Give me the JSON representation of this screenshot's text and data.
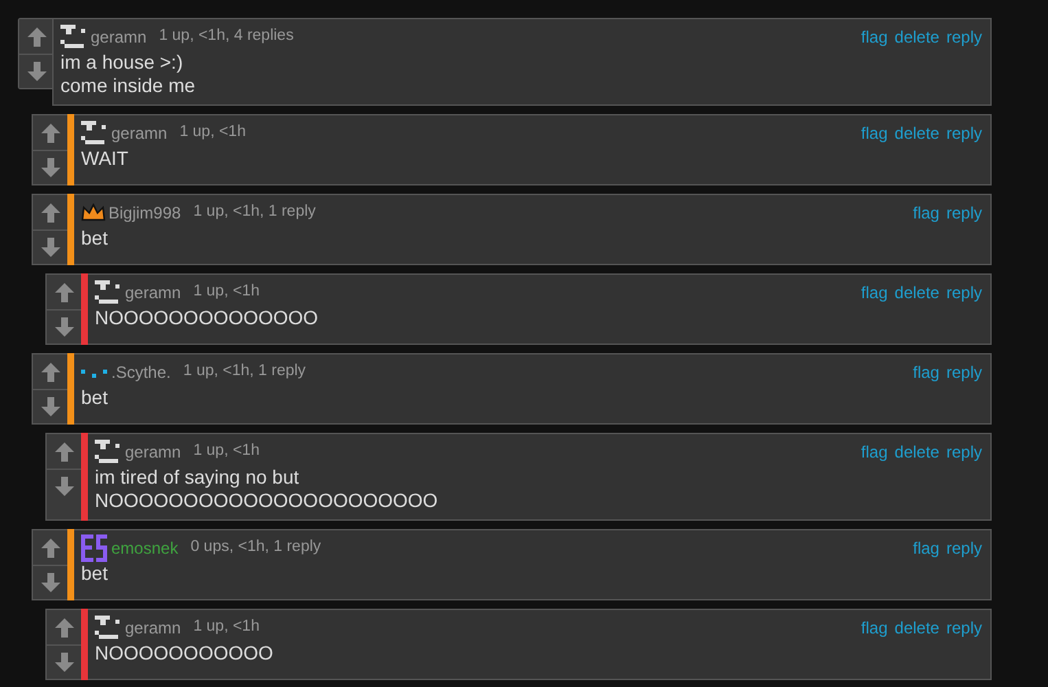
{
  "comments": [
    {
      "user": "geramn",
      "kind": "blocks",
      "color": "#9a9a9a",
      "meta": "1 up, <1h, 4 replies",
      "lines": [
        "im a house >:)",
        "come inside me"
      ],
      "actions": [
        "flag",
        "delete",
        "reply"
      ],
      "children": [
        {
          "user": "geramn",
          "kind": "blocks",
          "color": "#9a9a9a",
          "meta": "1 up, <1h",
          "lines": [
            "WAIT"
          ],
          "actions": [
            "flag",
            "delete",
            "reply"
          ]
        },
        {
          "user": "Bigjim998",
          "kind": "crown",
          "color": "#9a9a9a",
          "meta": "1 up, <1h, 1 reply",
          "lines": [
            "bet"
          ],
          "actions": [
            "flag",
            "reply"
          ],
          "children": [
            {
              "user": "geramn",
              "kind": "blocks",
              "color": "#9a9a9a",
              "meta": "1 up, <1h",
              "lines": [
                "NOOOOOOOOOOOOOO"
              ],
              "actions": [
                "flag",
                "delete",
                "reply"
              ]
            }
          ]
        },
        {
          "user": ".Scythe.",
          "kind": "dots",
          "color": "#9a9a9a",
          "meta": "1 up, <1h, 1 reply",
          "lines": [
            "bet"
          ],
          "actions": [
            "flag",
            "reply"
          ],
          "children": [
            {
              "user": "geramn",
              "kind": "blocks",
              "color": "#9a9a9a",
              "meta": "1 up, <1h",
              "lines": [
                "im tired of saying no but",
                "NOOOOOOOOOOOOOOOOOOOOOO"
              ],
              "actions": [
                "flag",
                "delete",
                "reply"
              ]
            }
          ]
        },
        {
          "user": "emosnek",
          "kind": "bars",
          "color": "#3fa33f",
          "meta": "0 ups, <1h, 1 reply",
          "lines": [
            "bet"
          ],
          "actions": [
            "flag",
            "reply"
          ],
          "children": [
            {
              "user": "geramn",
              "kind": "blocks",
              "color": "#9a9a9a",
              "meta": "1 up, <1h",
              "lines": [
                "NOOOOOOOOOOO"
              ],
              "actions": [
                "flag",
                "delete",
                "reply"
              ]
            }
          ]
        }
      ]
    }
  ]
}
